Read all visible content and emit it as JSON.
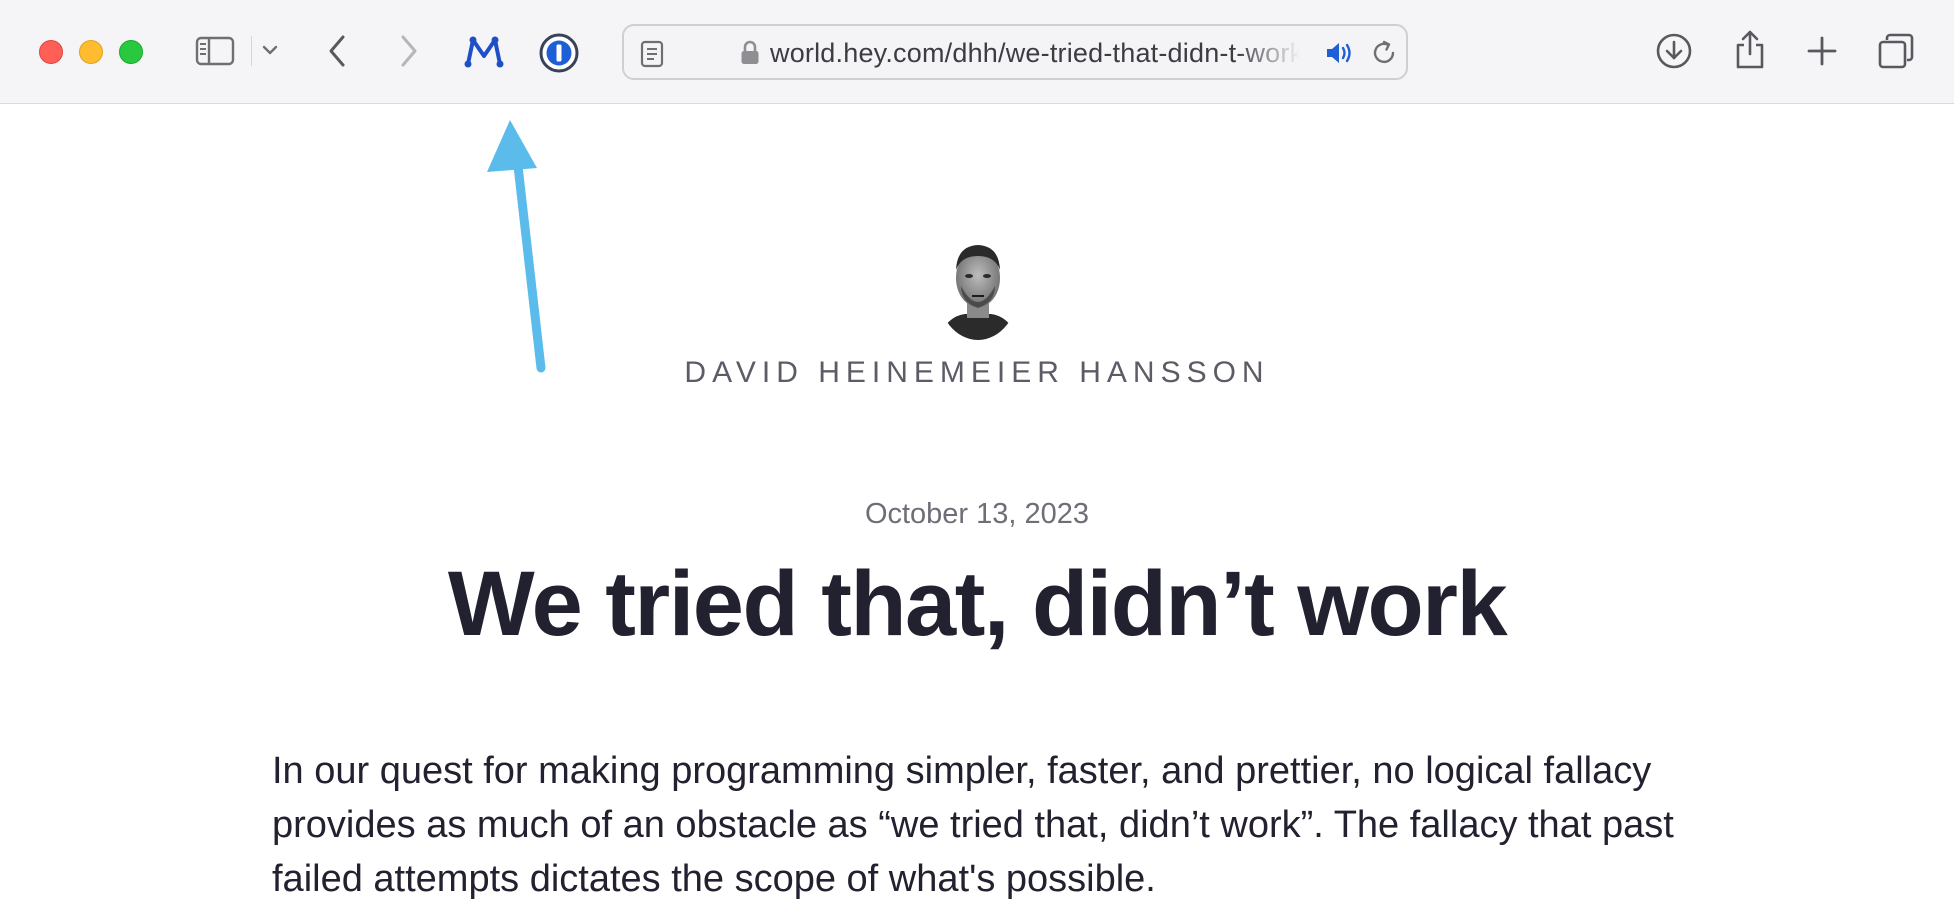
{
  "browser": {
    "window_controls": [
      "close",
      "minimize",
      "zoom"
    ],
    "toolbar_icons": {
      "sidebar": "sidebar-icon",
      "tab_group_menu": "chevron-down-icon",
      "back": "chevron-left-icon",
      "forward": "chevron-right-icon",
      "extension_m": "m-extension-icon",
      "password_manager": "password-manager-icon",
      "downloads": "download-icon",
      "share": "share-icon",
      "new_tab": "plus-icon",
      "tab_overview": "tabs-icon"
    },
    "address_bar": {
      "url": "world.hey.com/dhh/we-tried-that-didn-t-work",
      "secure": true,
      "audio_playing": true
    },
    "colors": {
      "toolbar_bg": "#f5f5f7",
      "accent_blue": "#1f5fd6",
      "annotation_arrow": "#5bbcec"
    }
  },
  "article": {
    "author": "DAVID HEINEMEIER HANSSON",
    "date": "October 13, 2023",
    "title": "We tried that, didn’t work",
    "paragraph": "In our quest for making programming simpler, faster, and prettier, no logical fallacy provides as much of an obstacle as “we tried that, didn’t work”. The fallacy that past failed attempts dictates the scope of what's possible."
  }
}
